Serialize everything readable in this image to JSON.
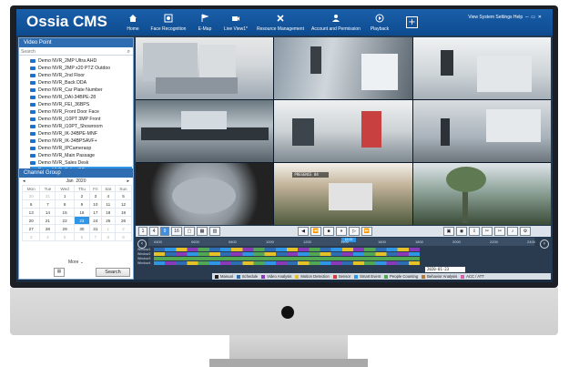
{
  "app": {
    "title": "Ossia CMS",
    "system_links": "View System Settings Help"
  },
  "nav": [
    {
      "label": "Home",
      "icon": "home-icon"
    },
    {
      "label": "Face Recognition",
      "icon": "face-recognition-icon"
    },
    {
      "label": "E-Map",
      "icon": "map-flag-icon"
    },
    {
      "label": "Live View1*",
      "icon": "camera-icon"
    },
    {
      "label": "Resource Management",
      "icon": "tools-icon"
    },
    {
      "label": "Account and Permission",
      "icon": "user-icon"
    },
    {
      "label": "Playback",
      "icon": "playback-icon"
    }
  ],
  "sidebar": {
    "video_point_title": "Video Point",
    "search_placeholder": "Search",
    "items": [
      "Demo NVR_2MP Ultra AHD",
      "Demo NVR_2MP x20 PTZ Outdoo",
      "Demo NVR_2nd Floor",
      "Demo NVR_Back DDA",
      "Demo NVR_Car Plate Number",
      "Demo NVR_DAI-34BPE-28",
      "Demo NVR_FEI_36BPS",
      "Demo NVR_Front Door Face",
      "Demo NVR_I10PT 3MP Front",
      "Demo NVR_I10PT_Showroom",
      "Demo NVR_IK-34BPE-MNF",
      "Demo NVR_IK-34BPSAVF+",
      "Demo NVR_IPCameraop",
      "Demo NVR_Main Passage",
      "Demo NVR_Sales Desk",
      "Demo NVR_Sales Office"
    ],
    "selected_index": 15,
    "channel_group_title": "Channel Group",
    "calendar": {
      "month": "Jan",
      "year": "2020",
      "weekdays": [
        "Mon",
        "Tue",
        "Wed",
        "Thu",
        "Fri",
        "Sat",
        "Sun"
      ],
      "weeks": [
        [
          "30",
          "31",
          "1",
          "2",
          "3",
          "4",
          "5"
        ],
        [
          "6",
          "7",
          "8",
          "9",
          "10",
          "11",
          "12"
        ],
        [
          "13",
          "14",
          "15",
          "16",
          "17",
          "18",
          "19"
        ],
        [
          "20",
          "21",
          "22",
          "23",
          "24",
          "25",
          "26"
        ],
        [
          "27",
          "28",
          "29",
          "30",
          "31",
          "1",
          "2"
        ],
        [
          "3",
          "4",
          "5",
          "6",
          "7",
          "8",
          "9"
        ]
      ],
      "selected_day": "23"
    },
    "more_label": "More",
    "search_button": "Search"
  },
  "video_grid": {
    "osd_text": "PRESENCE 04"
  },
  "controls": {
    "layout_buttons": [
      "1",
      "4",
      "9",
      "16"
    ],
    "playback_buttons": [
      "◀",
      "⏪",
      "■",
      "⏸",
      "▷",
      "⏩"
    ]
  },
  "timeline": {
    "ticks": [
      "0400",
      "0600",
      "0800",
      "1000",
      "1200",
      "1400",
      "1600",
      "1800",
      "2000",
      "2200",
      "2400"
    ],
    "now_label": "16:00",
    "track_labels": [
      "Window1",
      "Window2",
      "Window3",
      "Window4"
    ],
    "current_time": "2020-01-23 16:37:40"
  },
  "legend": [
    {
      "label": "Manual",
      "color": "#222222"
    },
    {
      "label": "Schedule",
      "color": "#2f6db2"
    },
    {
      "label": "Video Analysis",
      "color": "#8a3ab9"
    },
    {
      "label": "Motion Detection",
      "color": "#e6c229"
    },
    {
      "label": "Sensor",
      "color": "#d93b3b"
    },
    {
      "label": "Smart Event",
      "color": "#2f95e6"
    },
    {
      "label": "People Counting",
      "color": "#52a852"
    },
    {
      "label": "Behavior Analysis",
      "color": "#b07a3a"
    },
    {
      "label": "ACC / ATT",
      "color": "#d95fb0"
    }
  ]
}
